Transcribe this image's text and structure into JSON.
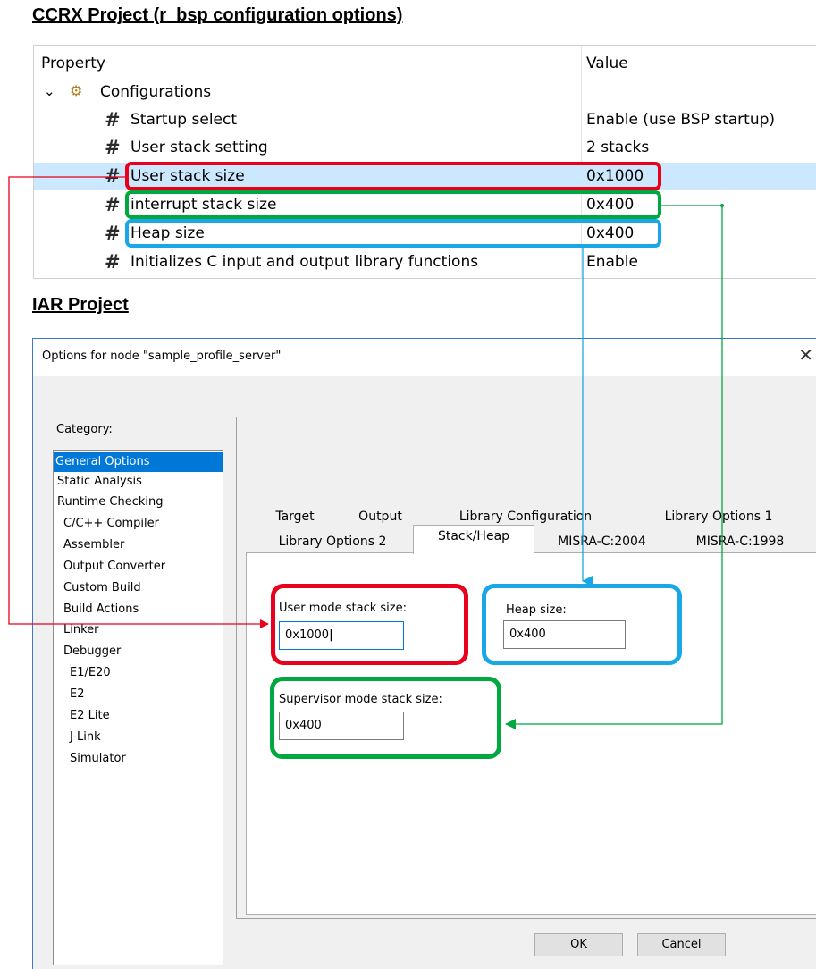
{
  "ccrx": {
    "heading": "CCRX Project (r_bsp configuration options)",
    "header": {
      "property": "Property",
      "value": "Value"
    },
    "group": {
      "toggle": "⌄",
      "icon": "⚙",
      "label": "Configurations"
    },
    "hash": "#",
    "rows": [
      {
        "name": "Startup select",
        "value": "Enable (use BSP startup)"
      },
      {
        "name": "User stack setting",
        "value": "2 stacks"
      },
      {
        "name": "User stack size",
        "value": "0x1000",
        "selected": true
      },
      {
        "name": "interrupt stack size",
        "value": "0x400"
      },
      {
        "name": "Heap size",
        "value": "0x400"
      },
      {
        "name": "Initializes C input and output library functions",
        "value": "Enable"
      }
    ]
  },
  "iar": {
    "heading": "IAR Project",
    "dialog_title": "Options for node \"sample_profile_server\"",
    "close_glyph": "✕",
    "category_label": "Category:",
    "categories": [
      "General Options",
      "Static Analysis",
      "Runtime Checking",
      "C/C++ Compiler",
      "Assembler",
      "Output Converter",
      "Custom Build",
      "Build Actions",
      "Linker",
      "Debugger",
      "E1/E20",
      "E2",
      "E2 Lite",
      "J-Link",
      "Simulator"
    ],
    "selected_category": "General Options",
    "tabs_row1": [
      "Target",
      "Output",
      "Library Configuration",
      "Library Options 1"
    ],
    "tabs_row2": [
      "Library Options 2",
      "Stack/Heap",
      "MISRA-C:2004",
      "MISRA-C:1998"
    ],
    "active_tab": "Stack/Heap",
    "user_stack_label": "User mode stack size:",
    "user_stack_value": "0x1000",
    "heap_label": "Heap size:",
    "heap_value": "0x400",
    "supervisor_label": "Supervisor mode stack size:",
    "supervisor_value": "0x400",
    "ok": "OK",
    "cancel": "Cancel"
  },
  "colors": {
    "red": "#e8001c",
    "green": "#00a83f",
    "blue": "#1aa7e6",
    "selection": "#cce8ff",
    "list_selection": "#0078d7"
  }
}
